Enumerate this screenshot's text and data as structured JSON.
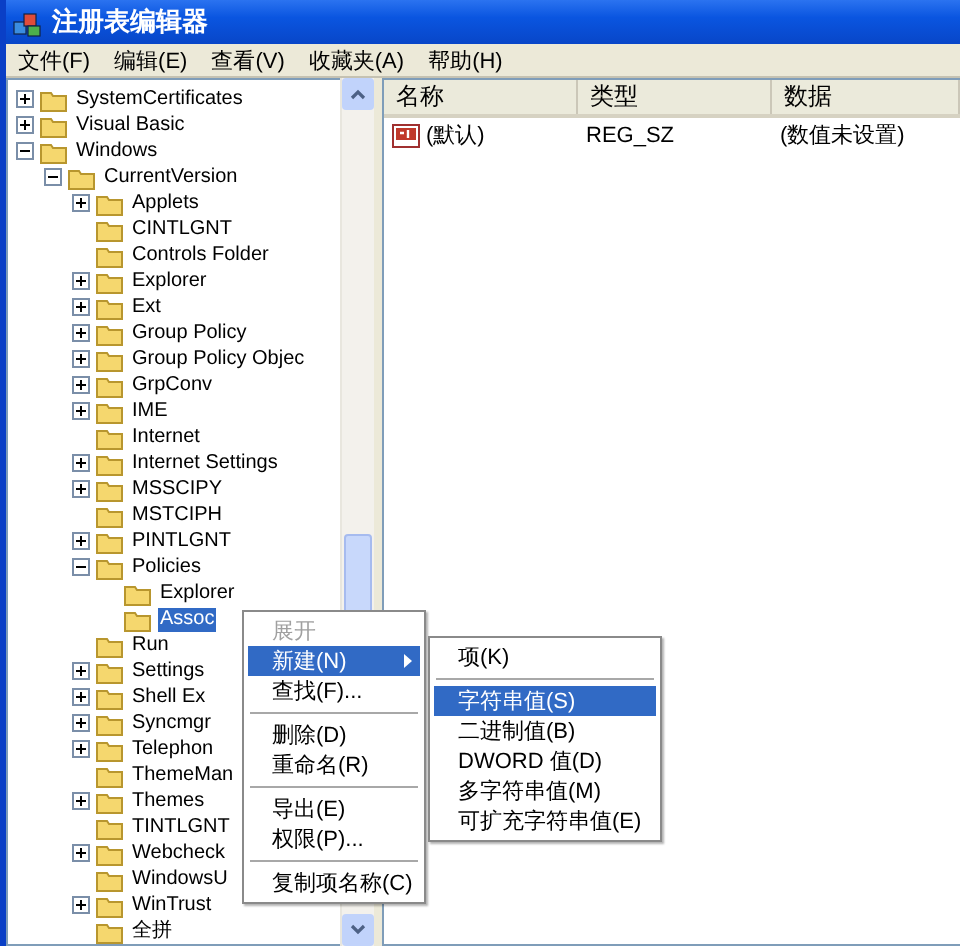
{
  "window": {
    "title": "注册表编辑器"
  },
  "menu_bar": [
    "文件(F)",
    "编辑(E)",
    "查看(V)",
    "收藏夹(A)",
    "帮助(H)"
  ],
  "tree": {
    "nodes": [
      {
        "label": "SystemCertificates",
        "has_children": true,
        "expanded": false,
        "selected": false
      },
      {
        "label": "Visual Basic",
        "has_children": true,
        "expanded": false,
        "selected": false
      },
      {
        "label": "Windows",
        "has_children": true,
        "expanded": true,
        "selected": false,
        "children": [
          {
            "label": "CurrentVersion",
            "has_children": true,
            "expanded": true,
            "selected": false,
            "children": [
              {
                "label": "Applets",
                "has_children": true,
                "expanded": false,
                "selected": false
              },
              {
                "label": "CINTLGNT",
                "has_children": false,
                "selected": false
              },
              {
                "label": "Controls Folder",
                "has_children": false,
                "selected": false
              },
              {
                "label": "Explorer",
                "has_children": true,
                "expanded": false,
                "selected": false
              },
              {
                "label": "Ext",
                "has_children": true,
                "expanded": false,
                "selected": false
              },
              {
                "label": "Group Policy",
                "has_children": true,
                "expanded": false,
                "selected": false
              },
              {
                "label": "Group Policy Objec",
                "has_children": true,
                "expanded": false,
                "selected": false
              },
              {
                "label": "GrpConv",
                "has_children": true,
                "expanded": false,
                "selected": false
              },
              {
                "label": "IME",
                "has_children": true,
                "expanded": false,
                "selected": false
              },
              {
                "label": "Internet",
                "has_children": false,
                "selected": false
              },
              {
                "label": "Internet Settings",
                "has_children": true,
                "expanded": false,
                "selected": false
              },
              {
                "label": "MSSCIPY",
                "has_children": true,
                "expanded": false,
                "selected": false
              },
              {
                "label": "MSTCIPH",
                "has_children": false,
                "selected": false
              },
              {
                "label": "PINTLGNT",
                "has_children": true,
                "expanded": false,
                "selected": false
              },
              {
                "label": "Policies",
                "has_children": true,
                "expanded": true,
                "selected": false,
                "children": [
                  {
                    "label": "Explorer",
                    "has_children": false,
                    "selected": false
                  },
                  {
                    "label": "Assoc",
                    "has_children": false,
                    "selected": true
                  }
                ]
              },
              {
                "label": "Run",
                "has_children": false,
                "selected": false
              },
              {
                "label": "Settings",
                "has_children": true,
                "expanded": false,
                "selected": false
              },
              {
                "label": "Shell Ex",
                "has_children": true,
                "expanded": false,
                "selected": false
              },
              {
                "label": "Syncmgr",
                "has_children": true,
                "expanded": false,
                "selected": false
              },
              {
                "label": "Telephon",
                "has_children": true,
                "expanded": false,
                "selected": false
              },
              {
                "label": "ThemeMan",
                "has_children": false,
                "selected": false
              },
              {
                "label": "Themes",
                "has_children": true,
                "expanded": false,
                "selected": false
              },
              {
                "label": "TINTLGNT",
                "has_children": false,
                "selected": false
              },
              {
                "label": "Webcheck",
                "has_children": true,
                "expanded": false,
                "selected": false
              },
              {
                "label": "WindowsU",
                "has_children": false,
                "selected": false
              },
              {
                "label": "WinTrust",
                "has_children": true,
                "expanded": false,
                "selected": false
              },
              {
                "label": "全拼",
                "has_children": false,
                "selected": false
              }
            ]
          }
        ]
      }
    ]
  },
  "list": {
    "columns": [
      "名称",
      "类型",
      "数据"
    ],
    "rows": [
      {
        "name": "(默认)",
        "type": "REG_SZ",
        "data": "(数值未设置)"
      }
    ]
  },
  "context_menu": {
    "items": [
      {
        "kind": "item",
        "label": "展开",
        "disabled": true,
        "selected": false,
        "submenu": false
      },
      {
        "kind": "item",
        "label": "新建(N)",
        "disabled": false,
        "selected": true,
        "submenu": true
      },
      {
        "kind": "item",
        "label": "查找(F)...",
        "disabled": false,
        "selected": false,
        "submenu": false
      },
      {
        "kind": "separator"
      },
      {
        "kind": "item",
        "label": "删除(D)",
        "disabled": false,
        "selected": false,
        "submenu": false
      },
      {
        "kind": "item",
        "label": "重命名(R)",
        "disabled": false,
        "selected": false,
        "submenu": false
      },
      {
        "kind": "separator"
      },
      {
        "kind": "item",
        "label": "导出(E)",
        "disabled": false,
        "selected": false,
        "submenu": false
      },
      {
        "kind": "item",
        "label": "权限(P)...",
        "disabled": false,
        "selected": false,
        "submenu": false
      },
      {
        "kind": "separator"
      },
      {
        "kind": "item",
        "label": "复制项名称(C)",
        "disabled": false,
        "selected": false,
        "submenu": false
      }
    ]
  },
  "submenu": {
    "items": [
      {
        "kind": "item",
        "label": "项(K)",
        "disabled": false,
        "selected": false,
        "submenu": false
      },
      {
        "kind": "separator"
      },
      {
        "kind": "item",
        "label": "字符串值(S)",
        "disabled": false,
        "selected": true,
        "submenu": false
      },
      {
        "kind": "item",
        "label": "二进制值(B)",
        "disabled": false,
        "selected": false,
        "submenu": false
      },
      {
        "kind": "item",
        "label": "DWORD 值(D)",
        "disabled": false,
        "selected": false,
        "submenu": false
      },
      {
        "kind": "item",
        "label": "多字符串值(M)",
        "disabled": false,
        "selected": false,
        "submenu": false
      },
      {
        "kind": "item",
        "label": "可扩充字符串值(E)",
        "disabled": false,
        "selected": false,
        "submenu": false
      }
    ]
  }
}
